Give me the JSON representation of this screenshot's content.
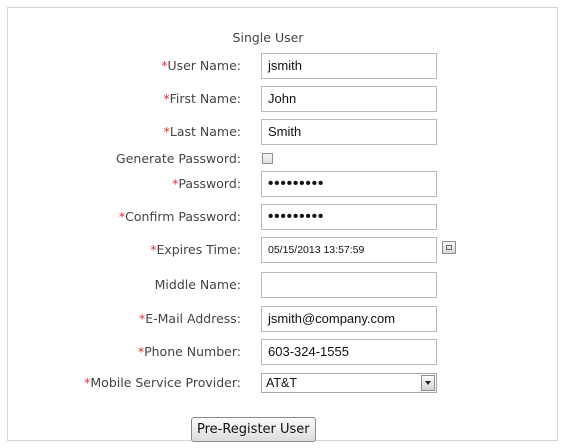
{
  "form": {
    "title": "Single User",
    "required_marker": "*",
    "fields": {
      "username": {
        "label": "User Name:",
        "value": "jsmith",
        "required": true
      },
      "first_name": {
        "label": "First Name:",
        "value": "John",
        "required": true
      },
      "last_name": {
        "label": "Last Name:",
        "value": "Smith",
        "required": true
      },
      "generate_password": {
        "label": "Generate Password:",
        "checked": false
      },
      "password": {
        "label": "Password:",
        "value": "•••••••••",
        "required": true
      },
      "confirm_password": {
        "label": "Confirm Password:",
        "value": "•••••••••",
        "required": true
      },
      "expires_time": {
        "label": "Expires Time:",
        "value": "05/15/2013 13:57:59",
        "required": true
      },
      "middle_name": {
        "label": "Middle Name:",
        "value": ""
      },
      "email": {
        "label": "E-Mail Address:",
        "value": "jsmith@company.com",
        "required": true
      },
      "phone": {
        "label": "Phone Number:",
        "value": "603-324-1555",
        "required": true
      },
      "mobile_provider": {
        "label": "Mobile Service Provider:",
        "value": "AT&T",
        "required": true
      }
    },
    "submit_label": "Pre-Register User"
  },
  "colors": {
    "required": "#e0303a",
    "border": "#d6d6d6"
  },
  "icons": {
    "calendar": "calendar-icon",
    "dropdown": "chevron-down-icon"
  }
}
